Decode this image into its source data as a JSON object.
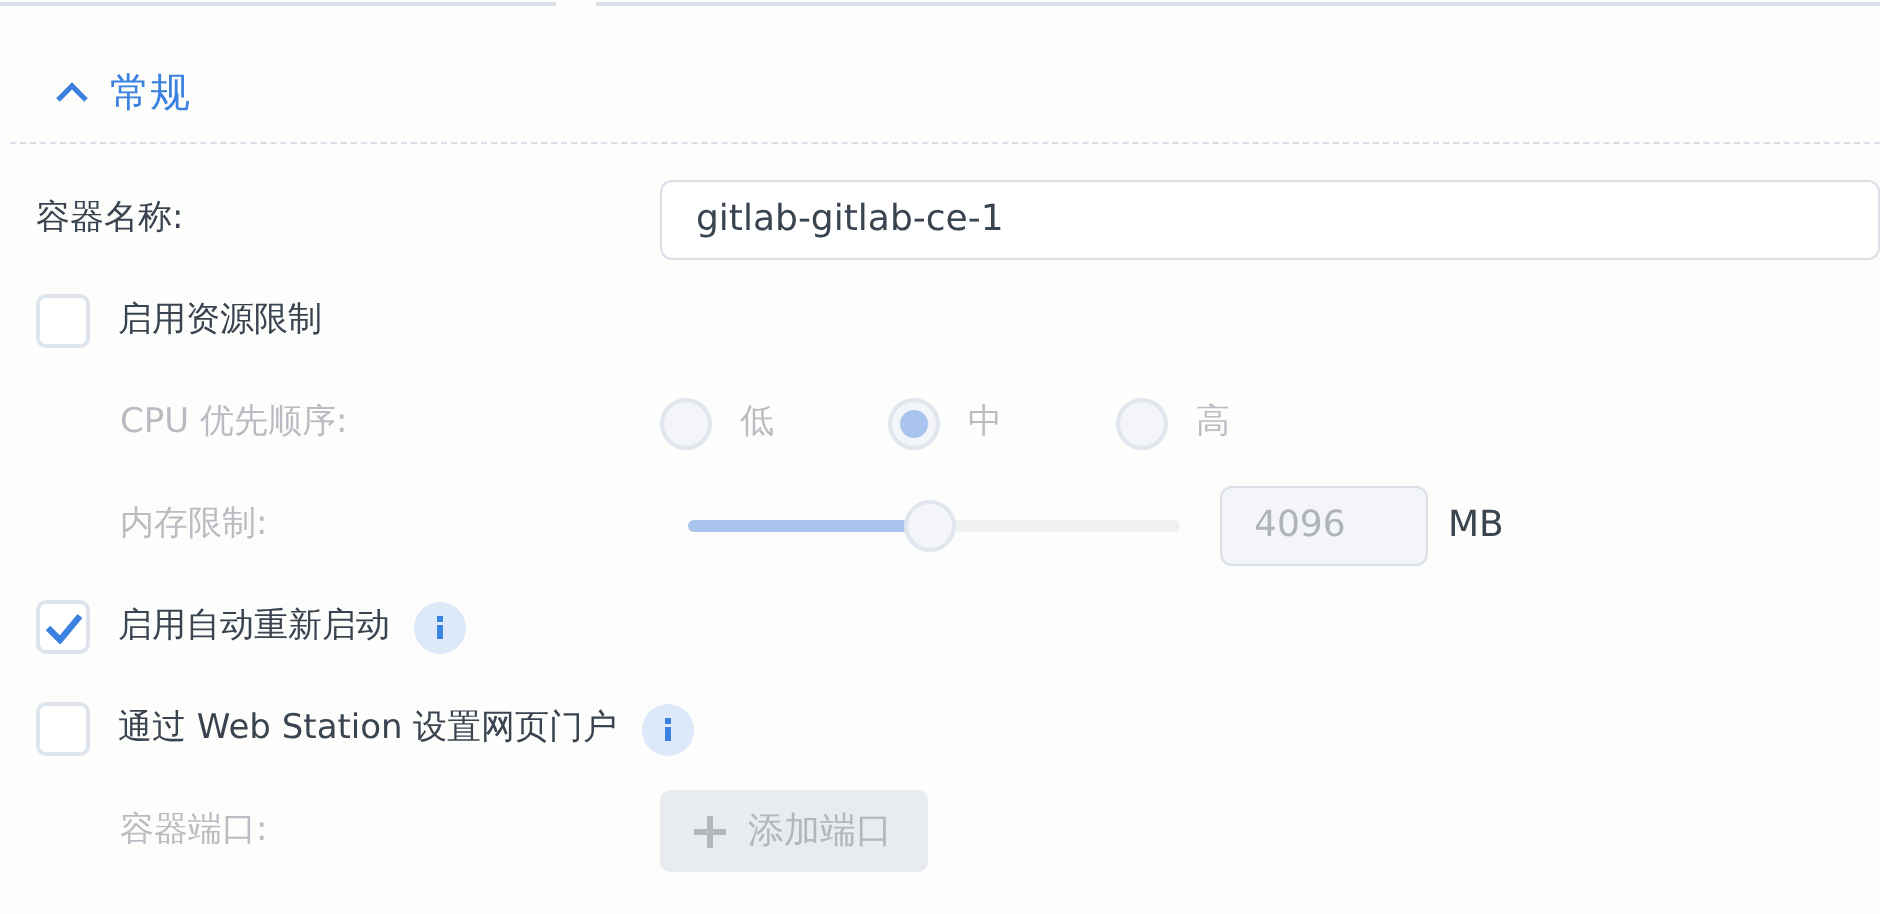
{
  "section": {
    "title": "常规",
    "expanded": true
  },
  "container_name": {
    "label": "容器名称:",
    "value": "gitlab-gitlab-ce-1"
  },
  "resource_limit": {
    "label": "启用资源限制",
    "checked": false
  },
  "cpu_priority": {
    "label": "CPU 优先顺序:",
    "disabled": true,
    "options": [
      {
        "label": "低",
        "selected": false
      },
      {
        "label": "中",
        "selected": true
      },
      {
        "label": "高",
        "selected": false
      }
    ]
  },
  "memory_limit": {
    "label": "内存限制:",
    "disabled": true,
    "level": 0.49,
    "value": "4096",
    "unit": "MB"
  },
  "auto_restart": {
    "label": "启用自动重新启动",
    "checked": true,
    "info": true
  },
  "web_portal": {
    "label": "通过 Web Station 设置网页门户",
    "checked": false,
    "info": true
  },
  "container_port": {
    "label": "容器端口:",
    "disabled": true,
    "button": "添加端口"
  }
}
